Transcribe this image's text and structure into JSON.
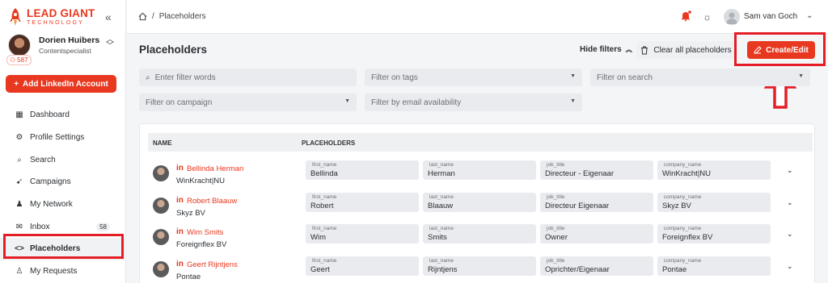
{
  "brand": {
    "name": "LEAD GIANT",
    "sub": "TECHNOLOGY",
    "color": "#e8381f"
  },
  "sidebar": {
    "collapse_icon": "«",
    "user": {
      "name": "Dorien Huibers",
      "role": "Contentspecialist",
      "badge": "587"
    },
    "add_button": "Add LinkedIn Account",
    "items": [
      {
        "label": "Dashboard",
        "icon": "dashboard-icon",
        "glyph": "▦"
      },
      {
        "label": "Profile Settings",
        "icon": "gear-icon",
        "glyph": "⚙"
      },
      {
        "label": "Search",
        "icon": "search-icon",
        "glyph": "⌕"
      },
      {
        "label": "Campaigns",
        "icon": "rocket-icon",
        "glyph": "➹"
      },
      {
        "label": "My Network",
        "icon": "network-icon",
        "glyph": "♟"
      },
      {
        "label": "Inbox",
        "icon": "inbox-icon",
        "glyph": "✉",
        "count": "58"
      },
      {
        "label": "Placeholders",
        "icon": "code-icon",
        "glyph": "<>",
        "active": true
      },
      {
        "label": "My Requests",
        "icon": "user-icon",
        "glyph": "♙"
      }
    ]
  },
  "topbar": {
    "breadcrumb": "Placeholders",
    "user_name": "Sam van Goch"
  },
  "header": {
    "title": "Placeholders",
    "hide_filters": "Hide filters",
    "clear_all": "Clear all placeholders",
    "create_edit": "Create/Edit"
  },
  "filters": {
    "words": "Enter filter words",
    "tags": "Filter on tags",
    "search": "Filter on search",
    "campaign": "Filter on campaign",
    "email": "Filter by email availability"
  },
  "table": {
    "col_name": "NAME",
    "col_placeholders": "PLACEHOLDERS",
    "li_label": "in",
    "rows": [
      {
        "name": "Bellinda Herman",
        "company": "WinKracht|NU",
        "fields": [
          {
            "label": "first_name",
            "value": "Bellinda"
          },
          {
            "label": "last_name",
            "value": "Herman"
          },
          {
            "label": "job_title",
            "value": "Directeur - Eigenaar"
          },
          {
            "label": "company_name",
            "value": "WinKracht|NU"
          }
        ]
      },
      {
        "name": "Robert Blaauw",
        "company": "Skyz BV",
        "fields": [
          {
            "label": "first_name",
            "value": "Robert"
          },
          {
            "label": "last_name",
            "value": "Blaauw"
          },
          {
            "label": "job_title",
            "value": "Directeur Eigenaar"
          },
          {
            "label": "company_name",
            "value": "Skyz BV"
          }
        ]
      },
      {
        "name": "Wim Smits",
        "company": "Foreignflex BV",
        "fields": [
          {
            "label": "first_name",
            "value": "Wim"
          },
          {
            "label": "last_name",
            "value": "Smits"
          },
          {
            "label": "job_title",
            "value": "Owner"
          },
          {
            "label": "company_name",
            "value": "Foreignflex BV"
          }
        ]
      },
      {
        "name": "Geert Rijntjens",
        "company": "Pontae",
        "fields": [
          {
            "label": "first_name",
            "value": "Geert"
          },
          {
            "label": "last_name",
            "value": "Rijntjens"
          },
          {
            "label": "job_title",
            "value": "Oprichter/Eigenaar"
          },
          {
            "label": "company_name",
            "value": "Pontae"
          }
        ]
      }
    ]
  },
  "annotation_color": "#e41e26"
}
